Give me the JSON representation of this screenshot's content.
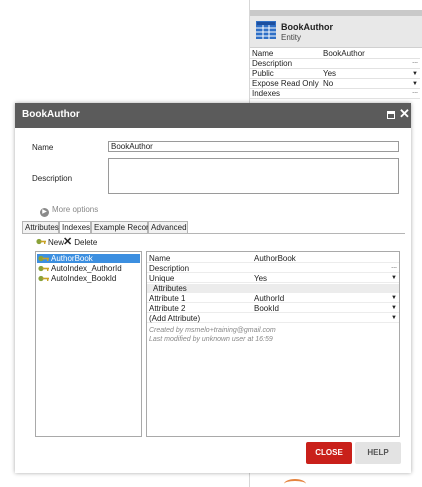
{
  "property_panel": {
    "title": "BookAuthor",
    "subtitle": "Entity",
    "rows": [
      {
        "key": "Name",
        "value": "BookAuthor",
        "control": "none"
      },
      {
        "key": "Description",
        "value": "",
        "control": "dots"
      },
      {
        "key": "Public",
        "value": "Yes",
        "control": "dropdown"
      },
      {
        "key": "Expose Read Only",
        "value": "No",
        "control": "dropdown"
      },
      {
        "key": "Indexes",
        "value": "",
        "control": "dots"
      }
    ],
    "dots_symbol": "...",
    "dropdown_symbol": "▼"
  },
  "dialog": {
    "title": "BookAuthor",
    "name_label": "Name",
    "name_value": "BookAuthor",
    "description_label": "Description",
    "description_value": "",
    "more_options": "More options",
    "tabs": [
      "Attributes",
      "Indexes",
      "Example Record",
      "Advanced"
    ],
    "active_tab": "Indexes",
    "toolbar": {
      "new_label": "New",
      "delete_label": "Delete"
    },
    "indexes": [
      {
        "label": "AuthorBook",
        "selected": true
      },
      {
        "label": "AutoIndex_AuthorId",
        "selected": false
      },
      {
        "label": "AutoIndex_BookId",
        "selected": false
      }
    ],
    "details": [
      {
        "key": "Name",
        "value": "AuthorBook",
        "control": "none"
      },
      {
        "key": "Description",
        "value": "",
        "control": "dots"
      },
      {
        "key": "Unique",
        "value": "Yes",
        "control": "dropdown"
      },
      {
        "key": "Attributes",
        "value": "",
        "control": "group"
      },
      {
        "key": "Attribute 1",
        "value": "AuthorId",
        "control": "dropdown"
      },
      {
        "key": "Attribute 2",
        "value": "BookId",
        "control": "dropdown"
      },
      {
        "key": "(Add Attribute)",
        "value": "",
        "control": "dropdown"
      }
    ],
    "created_by": "Created by msmelo+training@gmail.com",
    "modified_by": "Last modified by unknown user at 16:59",
    "close_button": "CLOSE",
    "help_button": "HELP"
  },
  "colors": {
    "titlebar": "#5b5b5b",
    "selection": "#3c8fe0",
    "close_button": "#c9201a",
    "help_button": "#e3e3e3",
    "entity_icon": "#2f6fc6",
    "key_icon": "#8aa23a"
  },
  "icons": {
    "entity": "entity-table-icon",
    "maximize": "maximize-icon",
    "close": "close-icon",
    "more_options": "chevron-right-icon",
    "new": "new-key-icon",
    "delete": "delete-x-icon",
    "index": "key-icon"
  }
}
